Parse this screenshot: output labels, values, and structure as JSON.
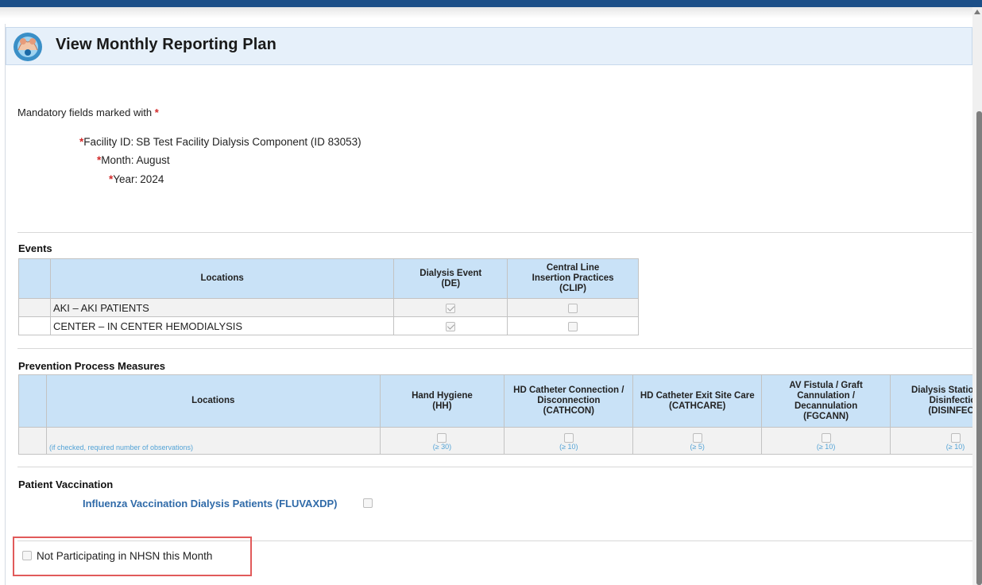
{
  "page": {
    "title": "View Monthly Reporting Plan",
    "mandatory_note": "Mandatory fields marked with",
    "required_marker": "*"
  },
  "fields": {
    "facility": {
      "label": "Facility ID:",
      "value": "SB Test Facility Dialysis Component (ID 83053)"
    },
    "month": {
      "label": "Month:",
      "value": "August"
    },
    "year": {
      "label": "Year:",
      "value": "2024"
    }
  },
  "events": {
    "title": "Events",
    "headers": {
      "locations": "Locations",
      "de_line1": "Dialysis Event",
      "de_line2": "(DE)",
      "clip_line1": "Central Line",
      "clip_line2": "Insertion Practices",
      "clip_line3": "(CLIP)"
    },
    "rows": [
      {
        "location": "AKI – AKI PATIENTS",
        "de_checked": true,
        "clip_checked": false
      },
      {
        "location": "CENTER – IN CENTER HEMODIALYSIS",
        "de_checked": true,
        "clip_checked": false
      }
    ]
  },
  "prevention": {
    "title": "Prevention Process Measures",
    "headers": {
      "locations": "Locations",
      "hh_line1": "Hand Hygiene",
      "hh_line2": "(HH)",
      "cathcon_line1": "HD Catheter Connection /",
      "cathcon_line2": "Disconnection",
      "cathcon_line3": "(CATHCON)",
      "cathcare_line1": "HD Catheter Exit Site Care",
      "cathcare_line2": "(CATHCARE)",
      "fgcann_line1": "AV Fistula / Graft",
      "fgcann_line2": "Cannulation /",
      "fgcann_line3": "Decannulation",
      "fgcann_line4": "(FGCANN)",
      "disinfect_line1": "Dialysis Station Rou",
      "disinfect_line2": "Disinfection",
      "disinfect_line3": "(DISINFECT)"
    },
    "note": "(if checked, required number of observations)",
    "requirements": {
      "hh": "(≥ 30)",
      "cathcon": "(≥ 10)",
      "cathcare": "(≥ 5)",
      "fgcann": "(≥ 10)",
      "disinfect": "(≥ 10)"
    }
  },
  "vaccination": {
    "title": "Patient Vaccination",
    "item_label": "Influenza Vaccination Dialysis Patients (FLUVAXDP)",
    "checked": false
  },
  "not_participating": {
    "label": "Not Participating in NHSN this Month",
    "checked": false
  },
  "colors": {
    "top_bar": "#1c4f88",
    "header_bg": "#e6f0fa",
    "table_header_bg": "#c9e2f7",
    "required_star": "#d22b2b",
    "link": "#2f6aa8",
    "highlight_box": "#e15a5a"
  }
}
